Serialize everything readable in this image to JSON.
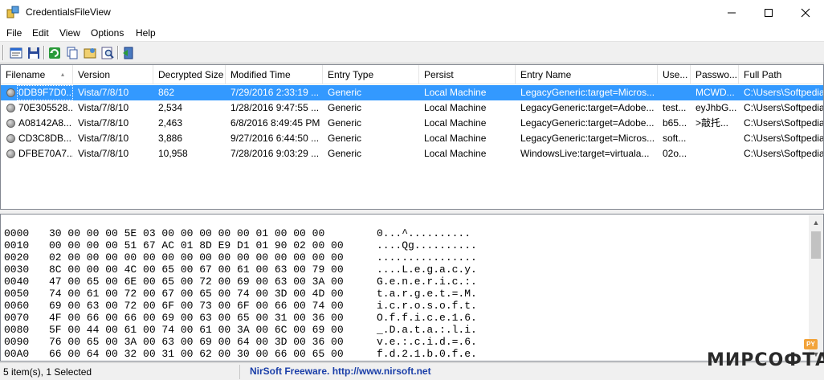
{
  "window": {
    "title": "CredentialsFileView",
    "minimize_icon": "minimize-icon",
    "maximize_icon": "maximize-icon",
    "close_icon": "close-icon"
  },
  "menu": [
    "File",
    "Edit",
    "View",
    "Options",
    "Help"
  ],
  "toolbar": {
    "icons": [
      "properties-icon",
      "save-icon",
      "refresh-icon",
      "copy-icon",
      "html-report-icon",
      "find-icon",
      "exit-icon"
    ]
  },
  "list": {
    "columns": [
      "Filename",
      "Version",
      "Decrypted Size",
      "Modified Time",
      "Entry Type",
      "Persist",
      "Entry Name",
      "Use...",
      "Passwo...",
      "Full Path"
    ],
    "rows": [
      [
        "0DB9F7D0...",
        "Vista/7/8/10",
        "862",
        "7/29/2016 2:33:19 ...",
        "Generic",
        "Local Machine",
        "LegacyGeneric:target=Micros...",
        "",
        "MCWD...",
        "C:\\Users\\Softpedia"
      ],
      [
        "70E305528...",
        "Vista/7/8/10",
        "2,534",
        "1/28/2016 9:47:55 ...",
        "Generic",
        "Local Machine",
        "LegacyGeneric:target=Adobe...",
        "test...",
        "eyJhbG...",
        "C:\\Users\\Softpedia"
      ],
      [
        "A08142A8...",
        "Vista/7/8/10",
        "2,463",
        "6/8/2016 8:49:45 PM",
        "Generic",
        "Local Machine",
        "LegacyGeneric:target=Adobe...",
        "b65...",
        ">敲托...",
        "C:\\Users\\Softpedia"
      ],
      [
        "CD3C8DB...",
        "Vista/7/8/10",
        "3,886",
        "9/27/2016 6:44:50 ...",
        "Generic",
        "Local Machine",
        "LegacyGeneric:target=Micros...",
        "soft...",
        "",
        "C:\\Users\\Softpedia"
      ],
      [
        "DFBE70A7...",
        "Vista/7/8/10",
        "10,958",
        "7/28/2016 9:03:29 ...",
        "Generic",
        "Local Machine",
        "WindowsLive:target=virtuala...",
        "02o...",
        "",
        "C:\\Users\\Softpedia"
      ]
    ],
    "selected_index": 0,
    "row_icon": "credential-file-icon"
  },
  "hex": {
    "lines": [
      {
        "offset": "0000",
        "bytes": "30 00 00 00 5E 03 00 00 00 00 00 01 00 00 00",
        "ascii": "0...^.........."
      },
      {
        "offset": "0010",
        "bytes": "00 00 00 00 51 67 AC 01 8D E9 D1 01 90 02 00 00",
        "ascii": "....Qg.........."
      },
      {
        "offset": "0020",
        "bytes": "02 00 00 00 00 00 00 00 00 00 00 00 00 00 00 00",
        "ascii": "................"
      },
      {
        "offset": "0030",
        "bytes": "8C 00 00 00 4C 00 65 00 67 00 61 00 63 00 79 00",
        "ascii": "....L.e.g.a.c.y."
      },
      {
        "offset": "0040",
        "bytes": "47 00 65 00 6E 00 65 00 72 00 69 00 63 00 3A 00",
        "ascii": "G.e.n.e.r.i.c.:."
      },
      {
        "offset": "0050",
        "bytes": "74 00 61 00 72 00 67 00 65 00 74 00 3D 00 4D 00",
        "ascii": "t.a.r.g.e.t.=.M."
      },
      {
        "offset": "0060",
        "bytes": "69 00 63 00 72 00 6F 00 73 00 6F 00 66 00 74 00",
        "ascii": "i.c.r.o.s.o.f.t."
      },
      {
        "offset": "0070",
        "bytes": "4F 00 66 00 66 00 69 00 63 00 65 00 31 00 36 00",
        "ascii": "O.f.f.i.c.e.1.6."
      },
      {
        "offset": "0080",
        "bytes": "5F 00 44 00 61 00 74 00 61 00 3A 00 6C 00 69 00",
        "ascii": "_.D.a.t.a.:.l.i."
      },
      {
        "offset": "0090",
        "bytes": "76 00 65 00 3A 00 63 00 69 00 64 00 3D 00 36 00",
        "ascii": "v.e.:.c.i.d.=.6."
      },
      {
        "offset": "00A0",
        "bytes": "66 00 64 00 32 00 31 00 62 00 30 00 66 00 65 00",
        "ascii": "f.d.2.1.b.0.f.e."
      }
    ]
  },
  "status": {
    "items": "5 item(s), 1 Selected",
    "credit": "NirSoft Freeware.  http://www.nirsoft.net"
  },
  "watermark": {
    "text": "МИРСОФТА",
    "badge": "PY"
  },
  "colors": {
    "selection": "#3399ff",
    "link": "#1a3ea8"
  }
}
